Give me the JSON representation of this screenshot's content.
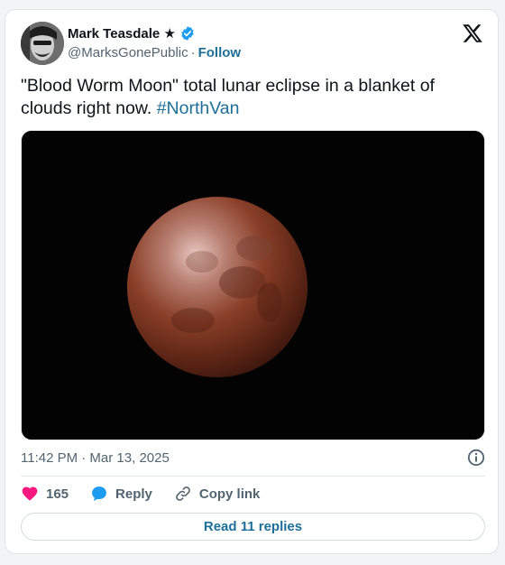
{
  "author": {
    "display_name": "Mark Teasdale ★",
    "handle": "@MarksGonePublic",
    "separator": "·",
    "follow_label": "Follow"
  },
  "tweet": {
    "text": "\"Blood Worm Moon\" total lunar eclipse in a blanket of clouds right now.",
    "hashtag": "#NorthVan"
  },
  "meta": {
    "timestamp": "11:42 PM · Mar 13, 2025"
  },
  "actions": {
    "like_count": "165",
    "reply_label": "Reply",
    "copy_link_label": "Copy link"
  },
  "read_replies_label": "Read 11 replies",
  "colors": {
    "link": "#1d6f98",
    "verified": "#1d9bf0",
    "like": "#f91880",
    "text": "#0f1419",
    "muted": "#536471"
  }
}
